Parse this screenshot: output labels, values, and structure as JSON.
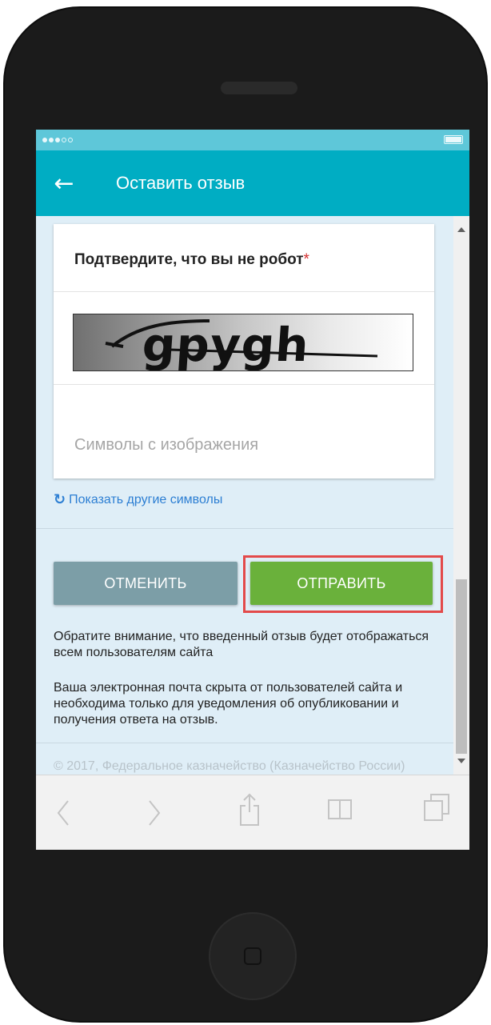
{
  "appbar": {
    "title": "Оставить отзыв"
  },
  "captcha": {
    "title": "Подтвердите, что вы не робот",
    "required_mark": "*",
    "image_text": "gpygh",
    "input_placeholder": "Символы с изображения",
    "refresh_label": "Показать другие символы"
  },
  "actions": {
    "cancel_label": "ОТМЕНИТЬ",
    "submit_label": "ОТПРАВИТЬ"
  },
  "notes": {
    "visibility": "Обратите внимание, что введенный отзыв будет отображаться всем пользователям сайта",
    "email": "Ваша электронная почта скрыта от пользователей сайта и необходима только для уведомления об опубликовании и получения ответа на отзыв."
  },
  "footer": {
    "copyright": "© 2017, Федеральное казначейство (Казначейство России)"
  },
  "browser_toolbar": {
    "icons": [
      "back-icon",
      "forward-icon",
      "share-icon",
      "bookmarks-icon",
      "tabs-icon"
    ]
  },
  "colors": {
    "appbar": "#00adc3",
    "submit": "#6ab13b",
    "cancel": "#7c9ea7",
    "highlight": "#e34a4a",
    "link": "#2d7fd3",
    "background": "#dfeef7"
  }
}
